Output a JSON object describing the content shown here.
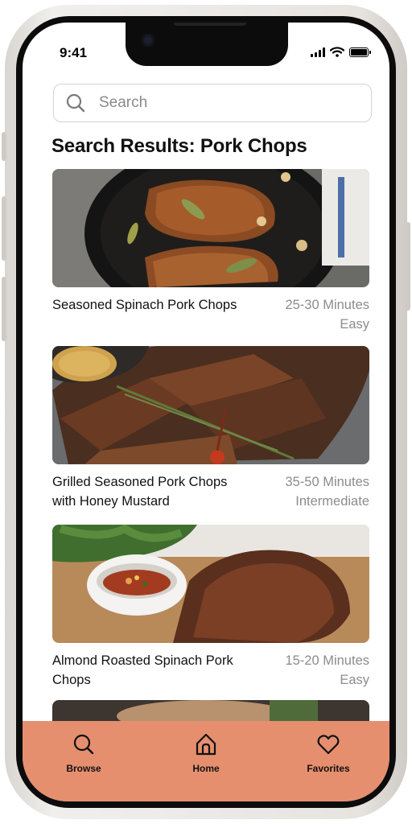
{
  "status_bar": {
    "time": "9:41"
  },
  "search": {
    "placeholder": "Search",
    "icon": "search-icon"
  },
  "page": {
    "title": "Search Results: Pork Chops"
  },
  "results": [
    {
      "title": "Seasoned Spinach Pork Chops",
      "time": "25-30 Minutes",
      "difficulty": "Easy",
      "image": "pork-chops-skillet"
    },
    {
      "title": "Grilled Seasoned Pork Chops with Honey Mustard",
      "time": "35-50 Minutes",
      "difficulty": "Intermediate",
      "image": "grilled-pork-rosemary"
    },
    {
      "title": "Almond Roasted Spinach Pork Chops",
      "time": "15-20 Minutes",
      "difficulty": "Easy",
      "image": "roasted-pork-sauce"
    },
    {
      "title": "",
      "time": "",
      "difficulty": "",
      "image": "partial-card"
    }
  ],
  "tab_bar": {
    "items": [
      {
        "label": "Browse",
        "icon": "search-icon"
      },
      {
        "label": "Home",
        "icon": "home-icon"
      },
      {
        "label": "Favorites",
        "icon": "heart-icon"
      }
    ]
  },
  "colors": {
    "accent": "#e58f6f",
    "text": "#111111",
    "muted": "#8c8c8c",
    "frame": "#0c0c0c"
  }
}
